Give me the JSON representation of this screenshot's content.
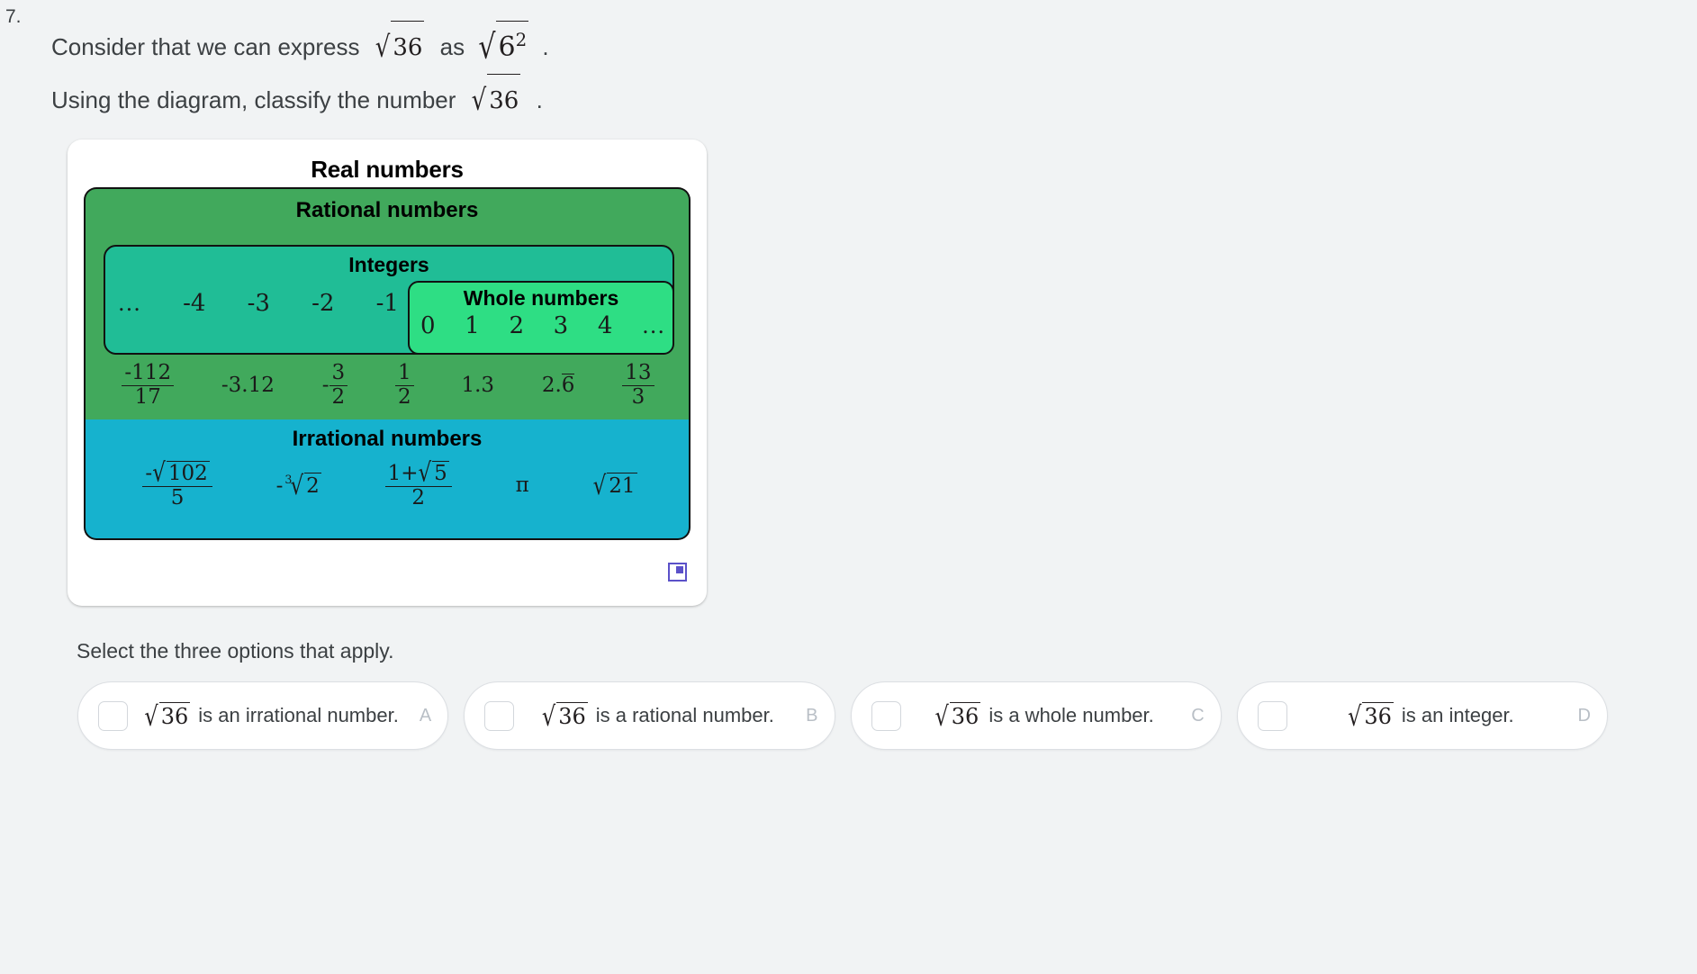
{
  "question": {
    "number": "7.",
    "stem_line1_before": "Consider that we can express",
    "stem_line1_middle": "as",
    "stem_line1_after": ".",
    "stem_line2_before": "Using the diagram, classify the number",
    "stem_line2_after": ".",
    "expr_sqrt36": "36",
    "expr_sqrt6sq_base": "6",
    "expr_sqrt6sq_exp": "2",
    "select_prompt": "Select the three options that apply."
  },
  "diagram": {
    "title": "Real numbers",
    "rational_label": "Rational numbers",
    "integers_label": "Integers",
    "whole_label": "Whole numbers",
    "irrational_label": "Irrational numbers",
    "integers_negatives": [
      "...",
      "-4",
      "-3",
      "-2",
      "-1"
    ],
    "whole_numbers": [
      "0",
      "1",
      "2",
      "3",
      "4",
      "..."
    ],
    "rational_examples": {
      "frac1_num": "-112",
      "frac1_den": "17",
      "decimal1": "-3.12",
      "frac2_sign": "-",
      "frac2_num": "3",
      "frac2_den": "2",
      "frac3_num": "1",
      "frac3_den": "2",
      "decimal2": "1.3",
      "repeating_whole": "2.",
      "repeating_bar": "6",
      "frac4_num": "13",
      "frac4_den": "3"
    },
    "irrational_examples": {
      "item1_sign": "-",
      "item1_radicand": "102",
      "item1_den": "5",
      "item2_sign": "-",
      "item2_index": "3",
      "item2_radicand": "2",
      "item3_num_prefix": "1+",
      "item3_num_radicand": "5",
      "item3_den": "2",
      "item4": "π",
      "item5_radicand": "21"
    },
    "expand_icon": "expand-image-icon",
    "colors": {
      "rational": "#41a95c",
      "integers": "#20bd96",
      "whole": "#2ede84",
      "irrational": "#16b2ce",
      "card": "#ffffff",
      "accent": "#5b51c9"
    }
  },
  "options": [
    {
      "radicand": "36",
      "text": "is an irrational number.",
      "letter": "A",
      "checked": false
    },
    {
      "radicand": "36",
      "text": "is a rational number.",
      "letter": "B",
      "checked": false
    },
    {
      "radicand": "36",
      "text": "is a whole number.",
      "letter": "C",
      "checked": false
    },
    {
      "radicand": "36",
      "text": "is an integer.",
      "letter": "D",
      "checked": false
    }
  ]
}
